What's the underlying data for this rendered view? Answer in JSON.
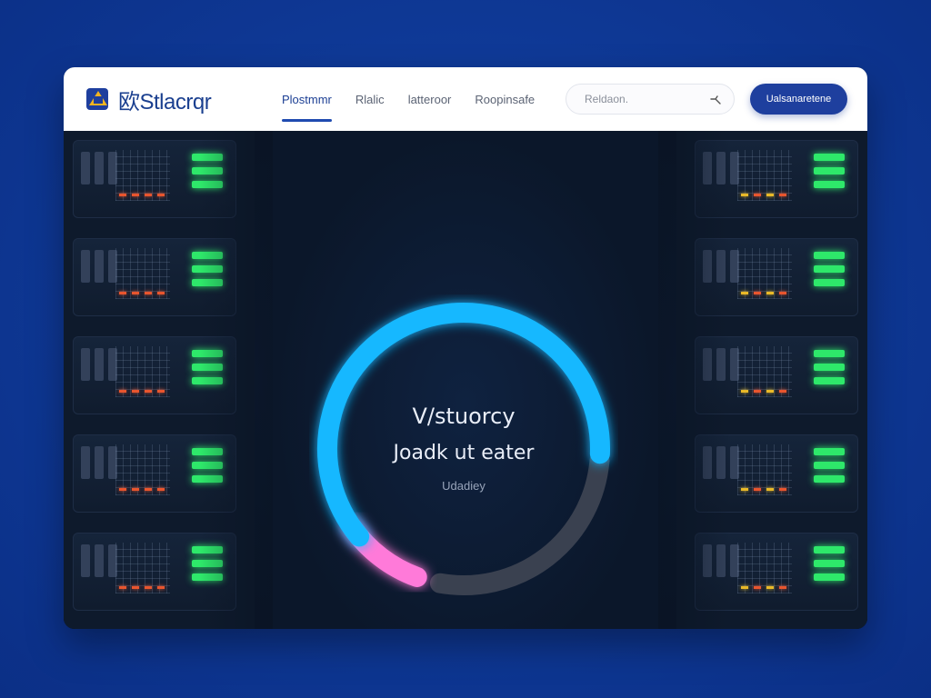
{
  "app": {
    "logo_text": "Stlacrqr",
    "logo_mark": "欧"
  },
  "nav": {
    "items": [
      {
        "label": "Plostmmr",
        "active": true
      },
      {
        "label": "Rlalic",
        "active": false
      },
      {
        "label": "latteroor",
        "active": false
      },
      {
        "label": "Roopinsafe",
        "active": false
      }
    ]
  },
  "search": {
    "placeholder": "Reldaon."
  },
  "cta": {
    "label": "Ualsanaretene"
  },
  "loader": {
    "title": "V/stuorcy",
    "subtitle": "Joadk ut eater",
    "status": "Udadiey",
    "progress_fraction": 0.72,
    "colors": {
      "primary_arc": "#19b8ff",
      "secondary_arc": "#ff7ad9",
      "track": "#3a4150"
    }
  },
  "icons": {
    "search_icon": "search-icon",
    "logo_icon": "logo-icon"
  },
  "colors": {
    "brand": "#1e3f9e",
    "background": "#0f3a98",
    "led": "#2ee86a"
  }
}
